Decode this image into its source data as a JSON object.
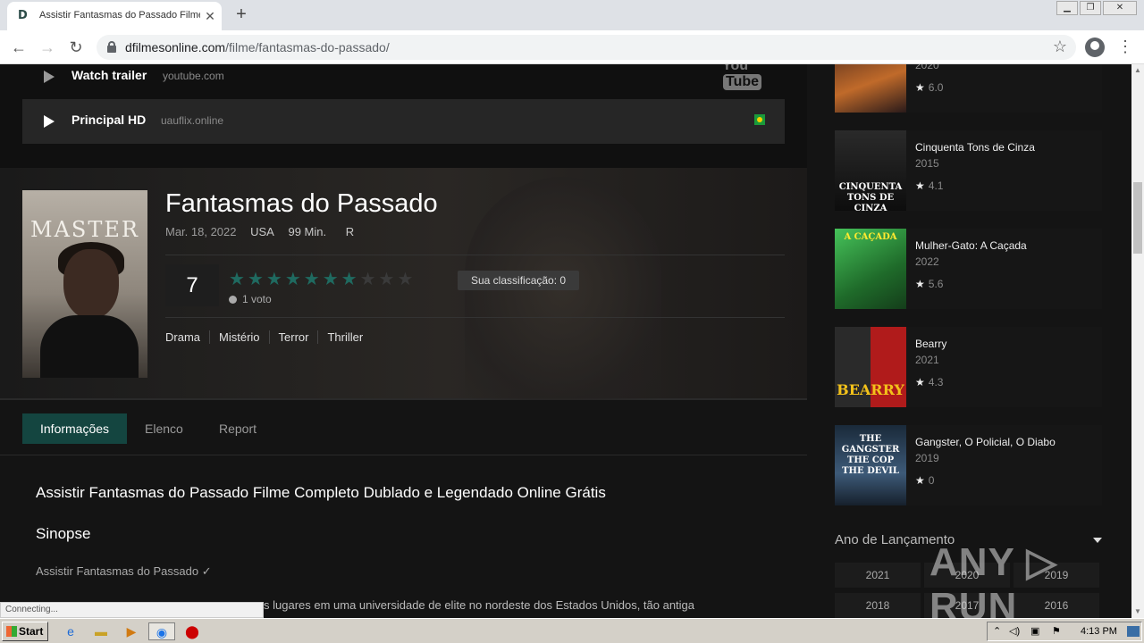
{
  "browser": {
    "tab_title": "Assistir Fantasmas do Passado Filme Completo Dublado e Legendado Online Grátis",
    "tab_close": "✕",
    "new_tab": "+",
    "url_domain": "dfilmesonline.com",
    "url_path": "/filme/fantasmas-do-passado/",
    "window_controls": [
      "▁",
      "❐",
      "✕"
    ]
  },
  "players": [
    {
      "name": "Watch trailer",
      "host": "youtube.com",
      "logo_a": "You",
      "logo_b": "Tube"
    },
    {
      "name": "Principal HD",
      "host": "uauflix.online"
    }
  ],
  "movie": {
    "poster_title": "MASTER",
    "title": "Fantasmas do Passado",
    "date": "Mar. 18, 2022",
    "country": "USA",
    "runtime": "99 Min.",
    "rating_code": "R",
    "score": "7",
    "stars_on": 7,
    "stars_total": 10,
    "votes": "1 voto",
    "your_rating": "Sua classificação: 0",
    "genres": [
      "Drama",
      "Mistério",
      "Terror",
      "Thriller"
    ]
  },
  "tabs": [
    "Informações",
    "Elenco",
    "Report"
  ],
  "content": {
    "heading": "Assistir Fantasmas do Passado Filme Completo Dublado e Legendado Online Grátis",
    "synopsis_heading": "Sinopse",
    "line1": "Assistir Fantasmas do Passado ✓",
    "line2": "s lugares em uma universidade de elite no nordeste dos Estados Unidos, tão antiga"
  },
  "sidebar": {
    "items": [
      {
        "title": "",
        "year": "2020",
        "rating": "6.0",
        "thumb_text": "",
        "color_a": "#3b1f1a",
        "color_b": "#c06a2a"
      },
      {
        "title": "Cinquenta Tons de Cinza",
        "year": "2015",
        "rating": "4.1",
        "thumb_text": "CINQUENTA TONS DE CINZA",
        "color_a": "#1a1a1a",
        "color_b": "#5a5a5a"
      },
      {
        "title": "Mulher-Gato: A Caçada",
        "year": "2022",
        "rating": "5.6",
        "thumb_text": "A CAÇADA",
        "color_a": "#1f6b2a",
        "color_b": "#46c35a"
      },
      {
        "title": "Bearry",
        "year": "2021",
        "rating": "4.3",
        "thumb_text": "BEARRY",
        "color_a": "#2a2a2a",
        "color_b": "#b01b1b"
      },
      {
        "title": "Gangster, O Policial, O Diabo",
        "year": "2019",
        "rating": "0",
        "thumb_text": "THE GANGSTER THE COP THE DEVIL",
        "color_a": "#1a2a3a",
        "color_b": "#3d5a78"
      }
    ],
    "year_heading": "Ano de Lançamento",
    "years": [
      "2021",
      "2020",
      "2019",
      "2018",
      "2017",
      "2016"
    ]
  },
  "watermark": "ANY ▷ RUN",
  "status": "Connecting...",
  "taskbar": {
    "start": "Start",
    "clock": "4:13 PM"
  }
}
